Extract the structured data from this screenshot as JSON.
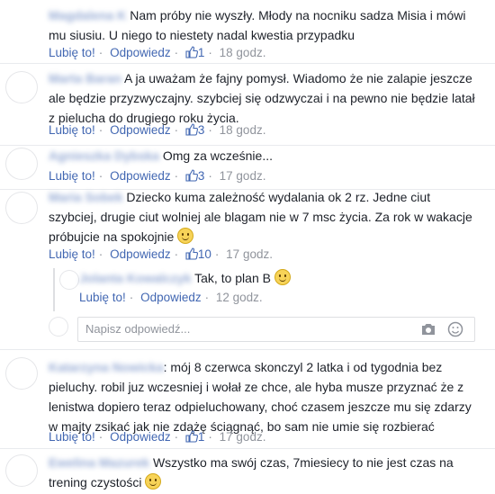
{
  "comments": [
    {
      "name": "Magdalena K",
      "text": "Nam próby nie wyszły. Młody na nocniku sadza Misia i mówi mu siusiu. U niego to niestety nadal kwestia przypadku",
      "like_label": "Lubię to!",
      "reply_label": "Odpowiedz",
      "likes": "1",
      "time": "18 godz."
    },
    {
      "name": "Marta Baran",
      "text": "A ja uważam że fajny pomysł. Wiadomo że nie zalapie jeszcze ale będzie przyzwyczajny. szybciej się odzwyczai i na pewno nie będzie latał z pielucha do drugiego roku życia.",
      "like_label": "Lubię to!",
      "reply_label": "Odpowiedz",
      "likes": "3",
      "time": "18 godz."
    },
    {
      "name": "Agnieszka Dybska",
      "text": "Omg za wcześnie...",
      "like_label": "Lubię to!",
      "reply_label": "Odpowiedz",
      "likes": "3",
      "time": "17 godz."
    },
    {
      "name": "Maria Sobek",
      "text": "Dziecko kuma zależność wydalania ok 2 rz. Jedne ciut szybciej, drugie ciut wolniej ale blagam nie w 7 msc życia. Za rok w wakacje próbujcie na spokojnie",
      "like_label": "Lubię to!",
      "reply_label": "Odpowiedz",
      "likes": "10",
      "time": "17 godz."
    },
    {
      "name": "Jolanta Kowalczyk",
      "text": "Tak, to plan B",
      "like_label": "Lubię to!",
      "reply_label": "Odpowiedz",
      "time": "12 godz."
    },
    {
      "name": "Katarzyna Nowicka",
      "text": ": mój 8 czerwca skonczyl 2 latka i od tygodnia bez pieluchy. robil juz wczesniej i wołał ze chce, ale hyba musze przyznać że z lenistwa dopiero teraz odpieluchowany, choć czasem jeszcze mu się zdarzy w majty zsikać jak nie zdążę ściągnąć, bo sam nie umie się rozbierać",
      "like_label": "Lubię to!",
      "reply_label": "Odpowiedz",
      "likes": "1",
      "time": "17 godz."
    },
    {
      "name": "Ewelina Mazurek",
      "text": "Wszystko ma swój czas, 7miesiecy to nie jest czas na trening czystości"
    }
  ],
  "reply_box": {
    "placeholder": "Napisz odpowiedź..."
  },
  "colors": {
    "link": "#4267b2",
    "meta": "#90949c",
    "text": "#1d2129"
  }
}
